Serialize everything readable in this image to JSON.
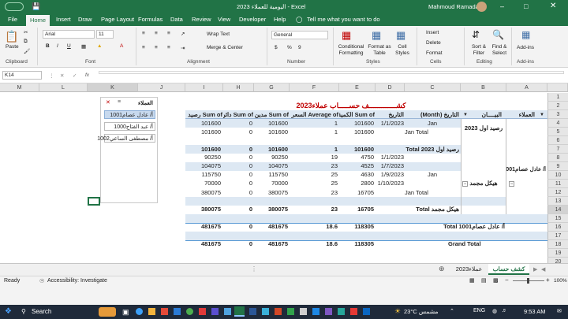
{
  "window": {
    "title": "اليومية للعملاء 2023 - Excel",
    "user": "Mahmoud Ramadan",
    "quick_save": "AutoSave"
  },
  "menu": {
    "tabs": [
      "File",
      "Home",
      "Insert",
      "Draw",
      "Page Layout",
      "Formulas",
      "Data",
      "Review",
      "View",
      "Developer",
      "Help"
    ],
    "search": "Tell me what you want to do"
  },
  "ribbon": {
    "clipboard": {
      "paste": "Paste",
      "label": "Clipboard"
    },
    "font": {
      "name": "Arial",
      "size": "11",
      "bold": "B",
      "italic": "I",
      "underline": "U",
      "label": "Font"
    },
    "alignment": {
      "wrap": "Wrap Text",
      "merge": "Merge & Center",
      "label": "Alignment"
    },
    "number": {
      "format": "General",
      "label": "Number"
    },
    "styles": {
      "conditional": "Conditional Formatting",
      "table": "Format as Table",
      "cell": "Cell Styles",
      "label": "Styles"
    },
    "cells": {
      "insert": "Insert",
      "delete": "Delete",
      "format": "Format",
      "label": "Cells"
    },
    "editing": {
      "sort": "Sort & Filter",
      "find": "Find & Select",
      "label": "Editing"
    },
    "addins": {
      "btn": "Add-ins",
      "label": "Add-ins"
    }
  },
  "formula_bar": {
    "name_box": "K14",
    "fx": "fx",
    "value": ""
  },
  "columns": [
    "A",
    "B",
    "C",
    "D",
    "E",
    "F",
    "G",
    "H",
    "I",
    "J",
    "K",
    "L",
    "M"
  ],
  "rows": [
    "1",
    "2",
    "3",
    "4",
    "5",
    "6",
    "7",
    "8",
    "9",
    "10",
    "11",
    "12",
    "13",
    "14",
    "15",
    "16",
    "17",
    "18",
    "19",
    "20",
    "21",
    "22"
  ],
  "sheet": {
    "title": "كشـــــــــــــف حســـــاب عملاء2023",
    "headers": {
      "a": "العملاء",
      "b": "البيــــان",
      "c": "التاريخ (Month)",
      "d": "التاريخ",
      "e": "Sum of الكمية",
      "f": "Average of السعر",
      "g": "Sum of مدين",
      "h": "Sum of دائن",
      "i": "Sum of رصيد"
    },
    "group1_label": "رصيد اول 2023",
    "jan": "Jan",
    "client": "أ/ عادل عصام1001",
    "hikel": "هيكل مجمد",
    "row4": {
      "d": "1/1/2023",
      "e": "101600",
      "f": "1",
      "g": "101600",
      "h": "0",
      "i": "101600"
    },
    "row5": {
      "c": "Jan Total",
      "e": "101600",
      "f": "1",
      "g": "101600",
      "h": "0",
      "i": "101600"
    },
    "row7": {
      "label": "رصيد اول 2023 Total",
      "e": "101600",
      "f": "1",
      "g": "101600",
      "h": "0",
      "i": "101600"
    },
    "detail": [
      {
        "d": "1/1/2023",
        "e": "4750",
        "f": "19",
        "g": "90250",
        "h": "0",
        "i": "90250"
      },
      {
        "d": "1/7/2023",
        "e": "4525",
        "f": "23",
        "g": "104075",
        "h": "0",
        "i": "104075"
      },
      {
        "d": "1/9/2023",
        "e": "4630",
        "f": "25",
        "g": "115750",
        "h": "0",
        "i": "115750"
      },
      {
        "d": "1/10/2023",
        "e": "2800",
        "f": "25",
        "g": "70000",
        "h": "0",
        "i": "70000"
      }
    ],
    "row13": {
      "c": "Jan Total",
      "e": "16705",
      "f": "23",
      "g": "380075",
      "h": "0",
      "i": "380075"
    },
    "row15": {
      "label": "هيكل مجمد Total",
      "e": "16705",
      "f": "23",
      "g": "380075",
      "h": "0",
      "i": "380075"
    },
    "row17": {
      "label": "أ/ عادل عصام1001 Total",
      "e": "118305",
      "f": "18.6",
      "g": "481675",
      "h": "0",
      "i": "481675"
    },
    "row19": {
      "label": "Grand Total",
      "e": "118305",
      "f": "18.6",
      "g": "481675",
      "h": "0",
      "i": "481675"
    }
  },
  "slicer": {
    "title": "العملاء",
    "items": [
      "أ/ عادل عصام1001",
      "أ/ عبد الفتاح1000",
      "أ/ مصطفى الساعي1002"
    ]
  },
  "sheet_tabs": [
    "كشف حساب",
    "عملاء2023"
  ],
  "status": {
    "ready": "Ready",
    "accessibility": "Accessibility: Investigate",
    "zoom": "100%"
  },
  "taskbar": {
    "search": "Search",
    "weather": "23°C مشمس",
    "time": "9:53 AM",
    "lang": "ENG"
  },
  "colors": {
    "accent": "#217346",
    "title_red": "#c00000",
    "band": "#dde8f3"
  }
}
